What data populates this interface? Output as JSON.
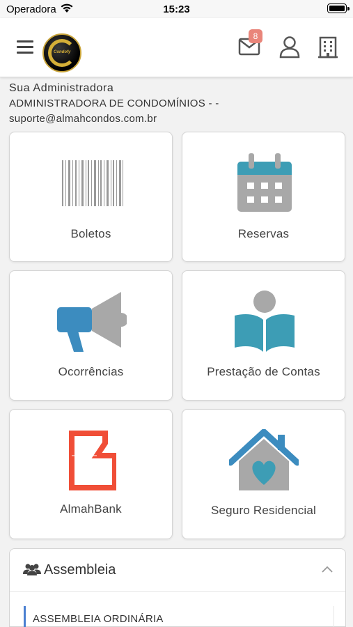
{
  "status_bar": {
    "carrier": "Operadora",
    "time": "15:23"
  },
  "header": {
    "mail_badge_count": "8",
    "logo_text": "Condofy"
  },
  "administrator": {
    "title": "Sua Administradora",
    "name": "ADMINISTRADORA DE CONDOMÍNIOS - -",
    "email": "suporte@almahcondos.com.br"
  },
  "tiles": [
    {
      "label": "Boletos",
      "icon": "barcode-icon"
    },
    {
      "label": "Reservas",
      "icon": "calendar-icon"
    },
    {
      "label": "Ocorrências",
      "icon": "megaphone-icon"
    },
    {
      "label": "Prestação de Contas",
      "icon": "reading-person-icon"
    },
    {
      "label": "AlmahBank",
      "icon": "almahbank-logo"
    },
    {
      "label": "Seguro Residencial",
      "icon": "house-heart-icon"
    }
  ],
  "assembly_panel": {
    "title": "Assembleia",
    "items": [
      "ASSEMBLEIA ORDINÁRIA"
    ]
  },
  "colors": {
    "teal": "#3d9db5",
    "blue": "#3c8cbf",
    "gray": "#a8a8a8",
    "red": "#f04e37",
    "accent_blue": "#4a7fd1",
    "badge": "#e9857a"
  }
}
